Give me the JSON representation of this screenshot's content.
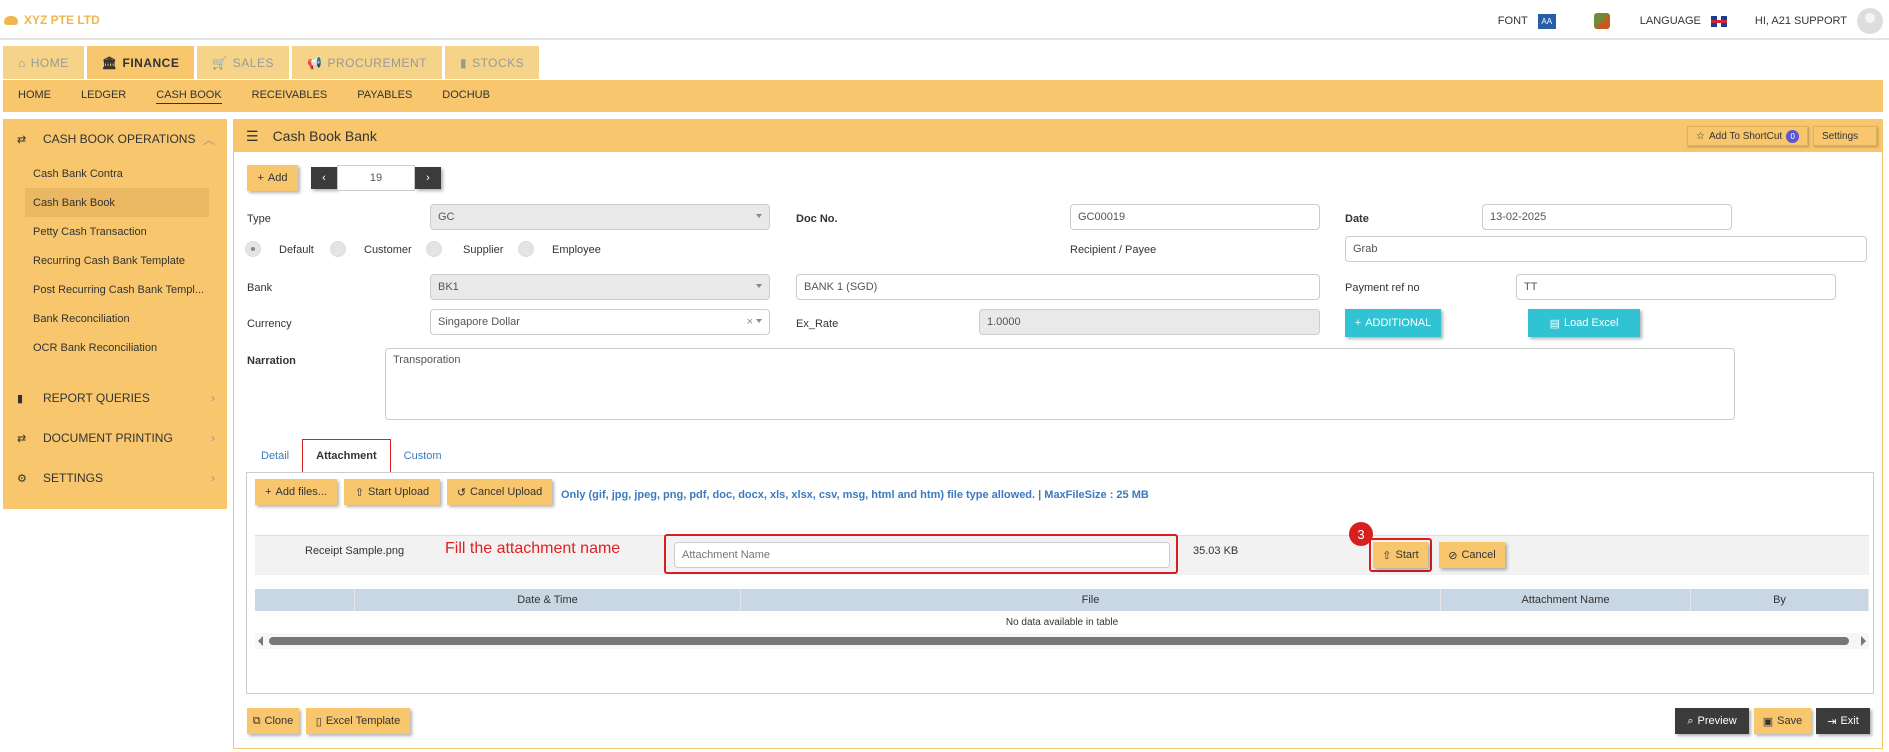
{
  "app": {
    "brand": "XYZ PTE LTD"
  },
  "topbar": {
    "font_label": "FONT",
    "font_icon_text": "AA",
    "language_label": "LANGUAGE",
    "user_label": "HI, A21 SUPPORT"
  },
  "modules": [
    {
      "label": "HOME",
      "icon": "home-icon"
    },
    {
      "label": "FINANCE",
      "icon": "bank-icon"
    },
    {
      "label": "SALES",
      "icon": "cart-icon"
    },
    {
      "label": "PROCUREMENT",
      "icon": "bullhorn-icon"
    },
    {
      "label": "STOCKS",
      "icon": "bar-chart-icon"
    }
  ],
  "subnav": [
    "HOME",
    "LEDGER",
    "CASH BOOK",
    "RECEIVABLES",
    "PAYABLES",
    "DOCHUB"
  ],
  "sidebar": {
    "section1": "CASH BOOK OPERATIONS",
    "items": [
      "Cash Bank Contra",
      "Cash Bank Book",
      "Petty Cash Transaction",
      "Recurring Cash Bank Template",
      "Post Recurring Cash Bank Templ...",
      "Bank Reconciliation",
      "OCR Bank Reconciliation"
    ],
    "section2": "REPORT QUERIES",
    "section3": "DOCUMENT PRINTING",
    "section4": "SETTINGS"
  },
  "main": {
    "title": "Cash Book Bank",
    "shortcut_label": "Add To ShortCut",
    "shortcut_count": "0",
    "settings_label": "Settings",
    "add_label": "Add",
    "record_no": "19"
  },
  "form": {
    "type_label": "Type",
    "type_value": "GC",
    "docno_label": "Doc No.",
    "docno_value": "GC00019",
    "date_label": "Date",
    "date_value": "13-02-2025",
    "radios": [
      "Default",
      "Customer",
      "Supplier",
      "Employee"
    ],
    "recipient_label": "Recipient / Payee",
    "recipient_value": "Grab",
    "bank_label": "Bank",
    "bank_value": "BK1",
    "bank_name": "BANK 1 (SGD)",
    "payref_label": "Payment ref no",
    "payref_value": "TT",
    "currency_label": "Currency",
    "currency_value": "Singapore Dollar",
    "currency_clear": "×",
    "exrate_label": "Ex_Rate",
    "exrate_value": "1.0000",
    "additional_label": "ADDITIONAL",
    "loadexcel_label": "Load Excel",
    "narration_label": "Narration",
    "narration_value": "Transporation"
  },
  "tabs": [
    "Detail",
    "Attachment",
    "Custom"
  ],
  "attachment": {
    "add_files": "Add files...",
    "start_upload": "Start Upload",
    "cancel_upload": "Cancel Upload",
    "allowed_text": "Only (gif, jpg, jpeg, png, pdf, doc, docx, xls, xlsx, csv, msg, html and htm) file type allowed. | MaxFileSize : 25 MB",
    "file_name": "Receipt Sample.png",
    "annotation": "Fill the attachment name",
    "name_placeholder": "Attachment Name",
    "file_size": "35.03 KB",
    "step_number": "3",
    "start_label": "Start",
    "cancel_label": "Cancel",
    "table_headers": [
      "Date & Time",
      "File",
      "Attachment Name",
      "By"
    ],
    "empty_text": "No data available in table"
  },
  "footer": {
    "clone": "Clone",
    "excel_template": "Excel Template",
    "preview": "Preview",
    "save": "Save",
    "exit": "Exit"
  }
}
